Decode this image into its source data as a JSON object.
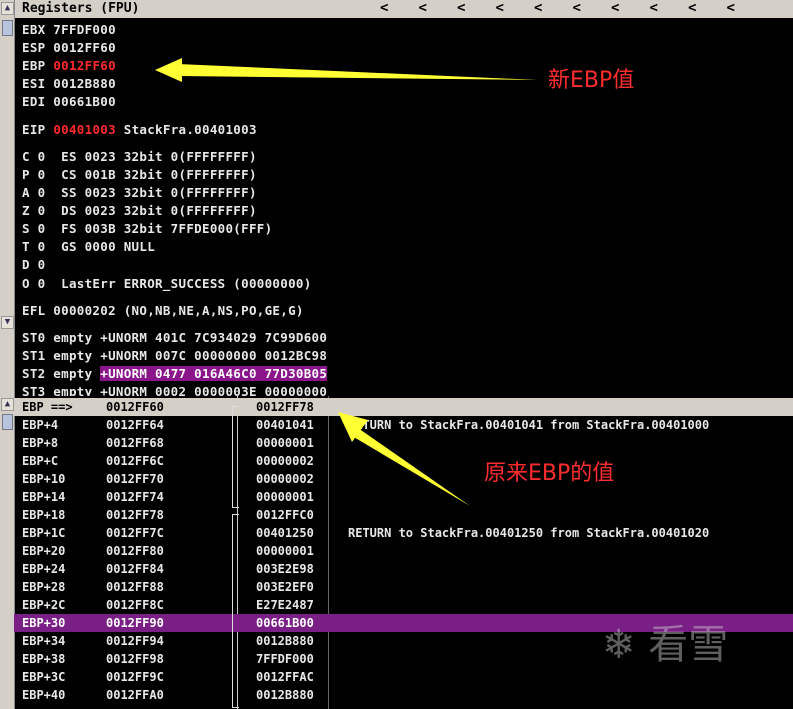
{
  "registers_pane": {
    "title": "Registers (FPU)",
    "nav_arrows": [
      "<",
      "<",
      "<",
      "<",
      "<",
      "<",
      "<",
      "<",
      "<",
      "<"
    ],
    "lines": [
      {
        "pre": "EBX 7FFDF000",
        "red": "",
        "post": ""
      },
      {
        "pre": "ESP 0012FF60",
        "red": "",
        "post": ""
      },
      {
        "pre": "EBP ",
        "red": "0012FF60",
        "post": ""
      },
      {
        "pre": "ESI 0012B880",
        "red": "",
        "post": ""
      },
      {
        "pre": "EDI 00661B00",
        "red": "",
        "post": ""
      },
      {
        "pre": "EIP ",
        "red": "00401003",
        "post": " StackFra.00401003"
      },
      {
        "pre": "C 0  ES 0023 32bit 0(FFFFFFFF)",
        "red": "",
        "post": ""
      },
      {
        "pre": "P 0  CS 001B 32bit 0(FFFFFFFF)",
        "red": "",
        "post": ""
      },
      {
        "pre": "A 0  SS 0023 32bit 0(FFFFFFFF)",
        "red": "",
        "post": ""
      },
      {
        "pre": "Z 0  DS 0023 32bit 0(FFFFFFFF)",
        "red": "",
        "post": ""
      },
      {
        "pre": "S 0  FS 003B 32bit 7FFDE000(FFF)",
        "red": "",
        "post": ""
      },
      {
        "pre": "T 0  GS 0000 NULL",
        "red": "",
        "post": ""
      },
      {
        "pre": "D 0",
        "red": "",
        "post": ""
      },
      {
        "pre": "O 0  LastErr ERROR_SUCCESS (00000000)",
        "red": "",
        "post": ""
      },
      {
        "pre": "EFL 00000202 (NO,NB,NE,A,NS,PO,GE,G)",
        "red": "",
        "post": ""
      },
      {
        "pre": "ST0 empty +UNORM 401C 7C934029 7C99D600",
        "red": "",
        "post": ""
      },
      {
        "pre": "ST1 empty +UNORM 007C 00000000 0012BC98",
        "red": "",
        "post": ""
      },
      {
        "pre": "ST2 empty ",
        "red": "",
        "post": "",
        "hl": "+UNORM 0477 016A46C0 77D30B05"
      },
      {
        "pre": "ST3 empty +UNORM 0002 0000003E 00000000",
        "red": "",
        "post": ""
      }
    ],
    "annotation_new_ebp": "新EBP值"
  },
  "stack_pane": {
    "rows": [
      {
        "label": "EBP ==>",
        "addr": "0012FF60",
        "value": "0012FF78",
        "comment": ""
      },
      {
        "label": "EBP+4",
        "addr": "0012FF64",
        "value": "00401041",
        "comment": "RETURN to StackFra.00401041 from StackFra.00401000"
      },
      {
        "label": "EBP+8",
        "addr": "0012FF68",
        "value": "00000001",
        "comment": ""
      },
      {
        "label": "EBP+C",
        "addr": "0012FF6C",
        "value": "00000002",
        "comment": ""
      },
      {
        "label": "EBP+10",
        "addr": "0012FF70",
        "value": "00000002",
        "comment": ""
      },
      {
        "label": "EBP+14",
        "addr": "0012FF74",
        "value": "00000001",
        "comment": ""
      },
      {
        "label": "EBP+18",
        "addr": "0012FF78",
        "value": "0012FFC0",
        "comment": ""
      },
      {
        "label": "EBP+1C",
        "addr": "0012FF7C",
        "value": "00401250",
        "comment": "RETURN to StackFra.00401250 from StackFra.00401020"
      },
      {
        "label": "EBP+20",
        "addr": "0012FF80",
        "value": "00000001",
        "comment": ""
      },
      {
        "label": "EBP+24",
        "addr": "0012FF84",
        "value": "003E2E98",
        "comment": ""
      },
      {
        "label": "EBP+28",
        "addr": "0012FF88",
        "value": "003E2EF0",
        "comment": ""
      },
      {
        "label": "EBP+2C",
        "addr": "0012FF8C",
        "value": "E27E2487",
        "comment": ""
      },
      {
        "label": "EBP+30",
        "addr": "0012FF90",
        "value": "00661B00",
        "comment": ""
      },
      {
        "label": "EBP+34",
        "addr": "0012FF94",
        "value": "0012B880",
        "comment": ""
      },
      {
        "label": "EBP+38",
        "addr": "0012FF98",
        "value": "7FFDF000",
        "comment": ""
      },
      {
        "label": "EBP+3C",
        "addr": "0012FF9C",
        "value": "0012FFAC",
        "comment": ""
      },
      {
        "label": "EBP+40",
        "addr": "0012FFA0",
        "value": "0012B880",
        "comment": ""
      }
    ],
    "annotation_original_ebp": "原来EBP的值"
  },
  "watermark": "看雪",
  "colors": {
    "highlight": "#8b158b",
    "red_value": "#ff2a2a",
    "arrow": "#ffff33",
    "annotation": "#ff2d2d"
  }
}
